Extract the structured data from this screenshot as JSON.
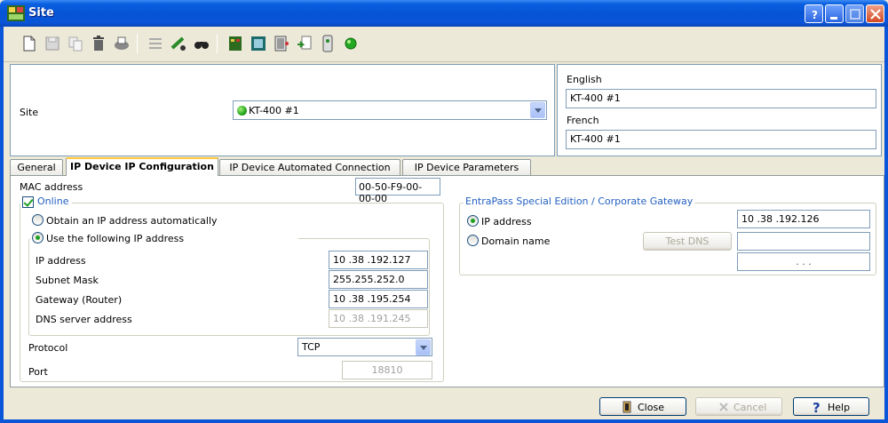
{
  "window": {
    "title": "Site"
  },
  "toolbar": {
    "icons": [
      "new-icon",
      "save-icon",
      "copy-icon",
      "delete-icon",
      "print-icon",
      "list-icon",
      "link-icon",
      "find-icon",
      "controller-icon",
      "device-icon",
      "door-icon",
      "import-icon",
      "reader-icon",
      "status-icon"
    ]
  },
  "site": {
    "label": "Site",
    "selected": "KT-400 #1"
  },
  "languages": {
    "english_label": "English",
    "english_value": "KT-400 #1",
    "french_label": "French",
    "french_value": "KT-400 #1"
  },
  "tabs": [
    {
      "label": "General"
    },
    {
      "label": "IP Device IP Configuration"
    },
    {
      "label": "IP Device Automated Connection"
    },
    {
      "label": "IP Device Parameters"
    }
  ],
  "ipconfig": {
    "mac_label": "MAC address",
    "mac_value": "00-50-F9-00-00-00",
    "online_label": "Online",
    "obtain_auto_label": "Obtain an IP address automatically",
    "use_following_label": "Use the following IP address",
    "ip_label": "IP address",
    "ip_value": "10 .38 .192.127",
    "subnet_label": "Subnet Mask",
    "subnet_value": "255.255.252.0",
    "gateway_label": "Gateway (Router)",
    "gateway_value": "10 .38 .195.254",
    "dns_label": "DNS server address",
    "dns_value": "10 .38 .191.245",
    "protocol_label": "Protocol",
    "protocol_value": "TCP",
    "port_label": "Port",
    "port_value": "18810"
  },
  "gateway_group": {
    "title": "EntraPass Special Edition / Corporate Gateway",
    "ip_label": "IP address",
    "ip_value": "10 .38 .192.126",
    "domain_label": "Domain name",
    "test_dns_label": "Test DNS",
    "domain_value": "",
    "resolved_ip_value": " .  .  . "
  },
  "buttons": {
    "close": "Close",
    "cancel": "Cancel",
    "help": "Help"
  }
}
